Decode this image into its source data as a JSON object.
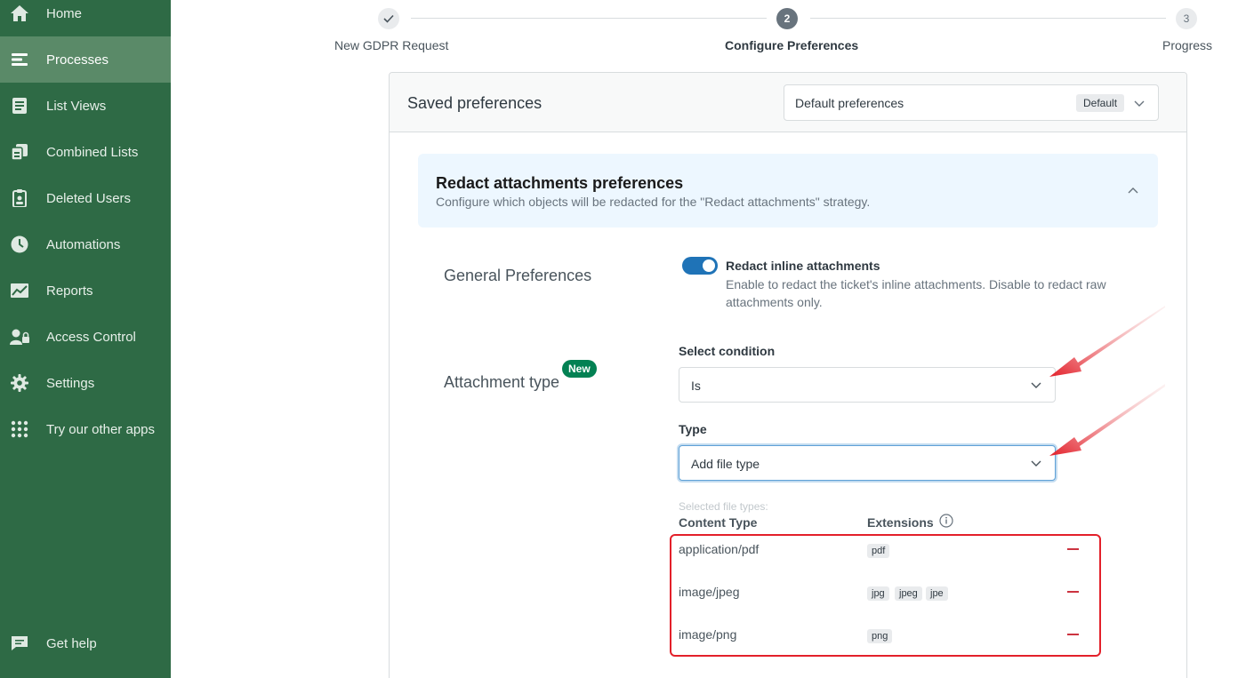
{
  "sidebar": {
    "items": [
      {
        "label": "Home",
        "icon": "home-icon"
      },
      {
        "label": "Processes",
        "icon": "processes-icon",
        "active": true
      },
      {
        "label": "List Views",
        "icon": "list-views-icon"
      },
      {
        "label": "Combined Lists",
        "icon": "combined-lists-icon"
      },
      {
        "label": "Deleted Users",
        "icon": "deleted-users-icon"
      },
      {
        "label": "Automations",
        "icon": "clock-icon"
      },
      {
        "label": "Reports",
        "icon": "chart-icon"
      },
      {
        "label": "Access Control",
        "icon": "user-lock-icon"
      },
      {
        "label": "Settings",
        "icon": "gear-icon"
      },
      {
        "label": "Try our other apps",
        "icon": "apps-grid-icon"
      }
    ],
    "help_label": "Get help"
  },
  "stepper": {
    "steps": [
      {
        "number": "",
        "label": "New GDPR Request",
        "state": "done"
      },
      {
        "number": "2",
        "label": "Configure Preferences",
        "state": "current"
      },
      {
        "number": "3",
        "label": "Progress",
        "state": "todo"
      }
    ]
  },
  "saved_preferences": {
    "title": "Saved preferences",
    "selected": "Default preferences",
    "badge": "Default"
  },
  "section": {
    "title": "Redact attachments preferences",
    "subtitle": "Configure which objects will be redacted for the \"Redact attachments\" strategy."
  },
  "general": {
    "label": "General Preferences",
    "toggle_title": "Redact inline attachments",
    "toggle_desc": "Enable to redact the ticket's inline attachments. Disable to redact raw attachments only.",
    "toggle_on": true
  },
  "attachment_type": {
    "label": "Attachment type",
    "new_badge": "New",
    "condition_label": "Select condition",
    "condition_value": "Is",
    "type_label": "Type",
    "type_value": "Add file type",
    "selected_caption": "Selected file types:",
    "col_content_type": "Content Type",
    "col_extensions": "Extensions",
    "rows": [
      {
        "content_type": "application/pdf",
        "extensions": [
          "pdf"
        ]
      },
      {
        "content_type": "image/jpeg",
        "extensions": [
          "jpg",
          "jpeg",
          "jpe"
        ]
      },
      {
        "content_type": "image/png",
        "extensions": [
          "png"
        ]
      }
    ]
  },
  "colors": {
    "sidebar": "#2e6a45",
    "sidebar_active": "#5a8a68",
    "toggle": "#1f73b7",
    "new_badge": "#038153",
    "remove": "#cc3340",
    "annotation": "#e3202a"
  }
}
